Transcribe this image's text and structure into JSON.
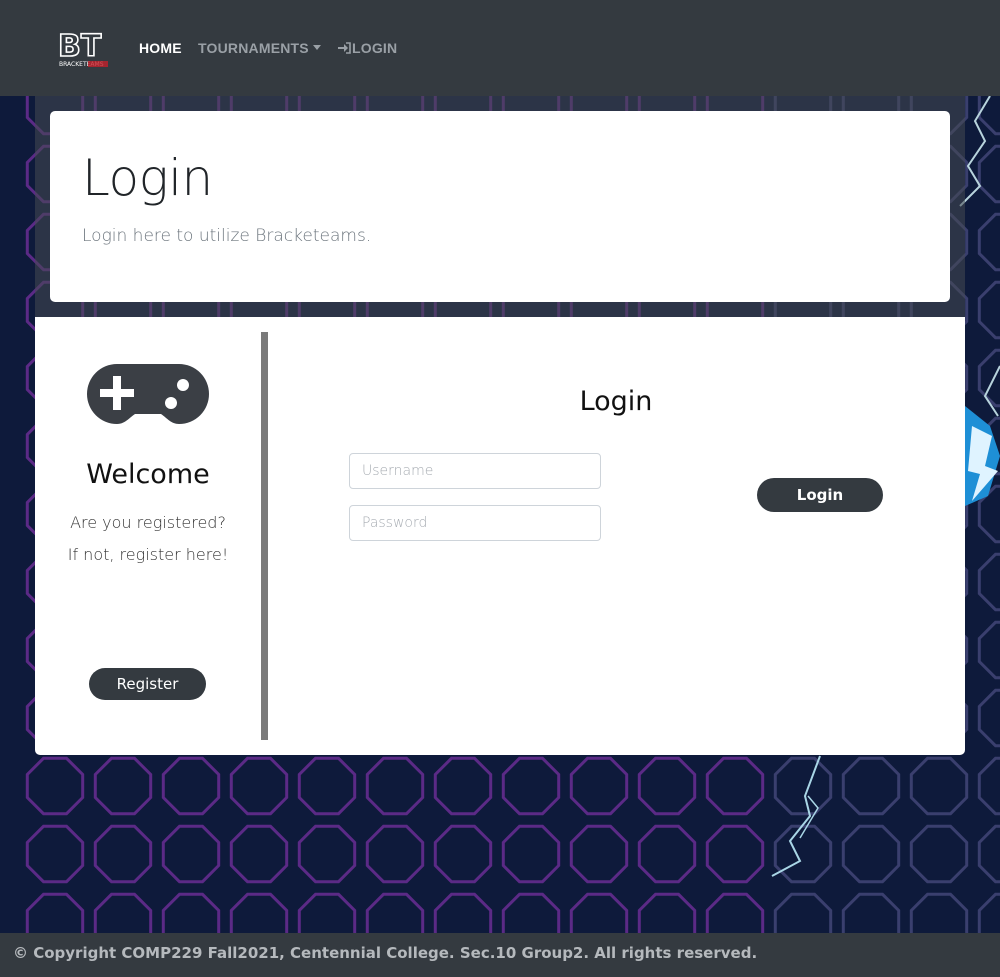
{
  "navbar": {
    "brand": "BT",
    "brand_sub": "BRACKETEAMS",
    "links": {
      "home": "HOME",
      "tournaments": "TOURNAMENTS",
      "login": "LOGIN"
    }
  },
  "jumbotron": {
    "title": "Login",
    "subtitle": "Login here to utilize Bracketeams."
  },
  "sidebar": {
    "icon": "gamepad-icon",
    "heading": "Welcome",
    "line1": "Are you registered?",
    "line2": "If not, register here!",
    "register_label": "Register"
  },
  "login_form": {
    "title": "Login",
    "username_placeholder": "Username",
    "password_placeholder": "Password",
    "submit_label": "Login"
  },
  "footer": {
    "text": "© Copyright COMP229 Fall2021, Centennial College. Sec.10 Group2. All rights reserved."
  },
  "colors": {
    "navbar": "#343a40",
    "background": "#0e1a3b",
    "hex_purple": "#5b2a86",
    "button": "#343a40"
  }
}
